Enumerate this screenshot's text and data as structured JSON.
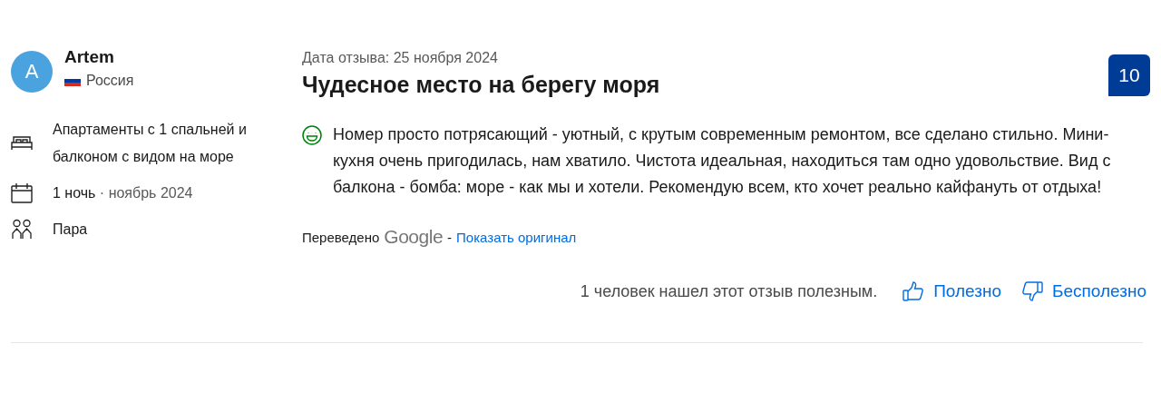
{
  "reviewer": {
    "initial": "A",
    "name": "Artem",
    "country": "Россия"
  },
  "details": [
    {
      "kind": "room",
      "text": "Апартаменты с 1 спальней и балконом с видом на море"
    },
    {
      "kind": "stay",
      "text": "1 ночь",
      "extra": "· ноябрь 2024"
    },
    {
      "kind": "group",
      "text": "Пара"
    }
  ],
  "review": {
    "date": "Дата отзыва: 25 ноября 2024",
    "title": "Чудесное место на берегу моря",
    "score": "10",
    "kind": "positive",
    "body": "Номер просто потрясающий - уютный, с крутым современным ремонтом, все сделано стильно. Мини-кухня очень пригодилась, нам хватило. Чистота идеальная, находиться там одно удовольствие. Вид с балкона - бомба: море - как мы и хотели. Рекомендую всем, кто хочет реально кайфануть от отдыха!",
    "translation": {
      "label": "Переведено",
      "service": "Google",
      "separator": "-",
      "link": "Показать оригинал"
    },
    "helpful_count": "1 человек нашел этот отзыв полезным.",
    "buttons": [
      {
        "kind": "helpful",
        "label": "Полезно"
      },
      {
        "kind": "unhelpful",
        "label": "Бесполезно"
      }
    ]
  }
}
